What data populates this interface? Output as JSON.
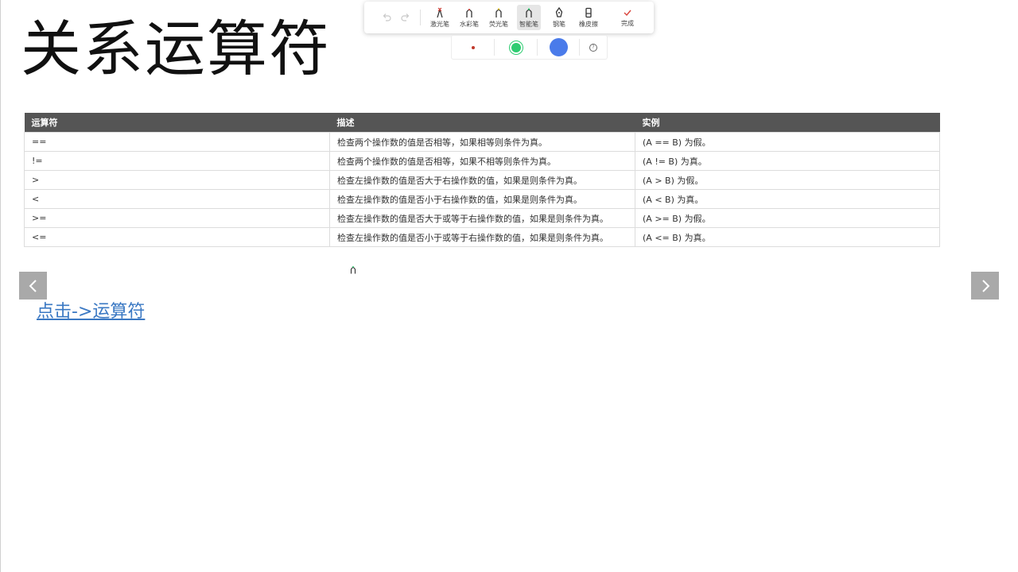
{
  "slide": {
    "title": "关系运算符",
    "link_text": "点击->运算符"
  },
  "toolbar": {
    "tools": [
      {
        "label": "激光笔",
        "icon": "laser-pen-icon"
      },
      {
        "label": "水彩笔",
        "icon": "watercolor-pen-icon"
      },
      {
        "label": "荧光笔",
        "icon": "highlighter-icon"
      },
      {
        "label": "智能笔",
        "icon": "smart-pen-icon"
      },
      {
        "label": "钢笔",
        "icon": "fountain-pen-icon"
      },
      {
        "label": "橡皮擦",
        "icon": "eraser-icon"
      }
    ],
    "done_label": "完成",
    "selected_tool": "智能笔"
  },
  "colors": {
    "small_dot": "#c0392b",
    "selected": "#2ecc71",
    "large_dot": "#4a7bea",
    "help_glyph": "?"
  },
  "table": {
    "headers": [
      "运算符",
      "描述",
      "实例"
    ],
    "rows": [
      [
        "==",
        "检查两个操作数的值是否相等，如果相等则条件为真。",
        "(A == B) 为假。"
      ],
      [
        "!=",
        "检查两个操作数的值是否相等，如果不相等则条件为真。",
        "(A != B) 为真。"
      ],
      [
        ">",
        "检查左操作数的值是否大于右操作数的值，如果是则条件为真。",
        "(A > B) 为假。"
      ],
      [
        "<",
        "检查左操作数的值是否小于右操作数的值，如果是则条件为真。",
        "(A < B) 为真。"
      ],
      [
        ">=",
        "检查左操作数的值是否大于或等于右操作数的值，如果是则条件为真。",
        "(A >= B) 为假。"
      ],
      [
        "<=",
        "检查左操作数的值是否小于或等于右操作数的值，如果是则条件为真。",
        "(A <= B) 为真。"
      ]
    ]
  }
}
